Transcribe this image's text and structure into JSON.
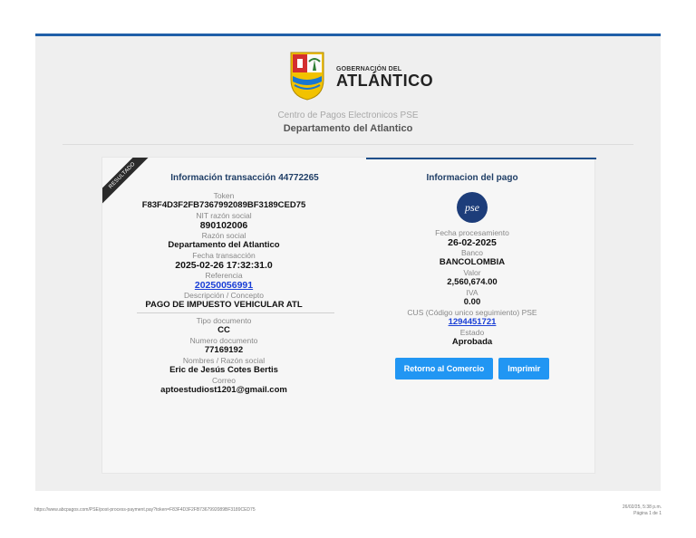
{
  "header": {
    "brand_top": "GOBERNACIÓN DEL",
    "brand_big": "ATLÁNTICO",
    "subtitle": "Centro de Pagos Electronicos PSE",
    "subtitle2": "Departamento del Atlantico"
  },
  "ribbon": "RESULTADO",
  "transaction": {
    "title": "Información transacción 44772265",
    "token_label": "Token",
    "token_value": "F83F4D3F2FB7367992089BF3189CED75",
    "nit_label": "NIT razón social",
    "nit_value": "890102006",
    "razon_label": "Razón social",
    "razon_value": "Departamento del Atlantico",
    "fecha_label": "Fecha transacción",
    "fecha_value": "2025-02-26 17:32:31.0",
    "ref_label": "Referencia",
    "ref_value": "20250056991",
    "desc_label": "Descripción / Concepto",
    "desc_value": "PAGO DE IMPUESTO VEHICULAR ATL",
    "tipo_label": "Tipo documento",
    "tipo_value": "CC",
    "num_label": "Numero documento",
    "num_value": "77169192",
    "nombres_label": "Nombres / Razón social",
    "nombres_value": "Eric de Jesús Cotes Bertis",
    "correo_label": "Correo",
    "correo_value": "aptoestudiost1201@gmail.com"
  },
  "payment": {
    "title": "Informacion del pago",
    "logo_text": "pse",
    "fecha_label": "Fecha procesamiento",
    "fecha_value": "26-02-2025",
    "banco_label": "Banco",
    "banco_value": "BANCOLOMBIA",
    "valor_label": "Valor",
    "valor_value": "2,560,674.00",
    "iva_label": "IVA",
    "iva_value": "0.00",
    "cus_label": "CUS (Código unico seguimiento) PSE",
    "cus_value": "1294451721",
    "estado_label": "Estado",
    "estado_value": "Aprobada",
    "btn_retorno": "Retorno al Comercio",
    "btn_imprimir": "Imprimir"
  },
  "footer": {
    "url": "https://www.abcpagos.com/PSE/post-process-payment.pay?token=F83F4D3F2FB7367992089BF3189CED75",
    "date": "26/02/25, 5:38 p.m.",
    "page": "Página 1 de 1"
  },
  "colors": {
    "accent": "#1f5fa8",
    "button": "#2196f3",
    "link": "#1a3fd6"
  }
}
